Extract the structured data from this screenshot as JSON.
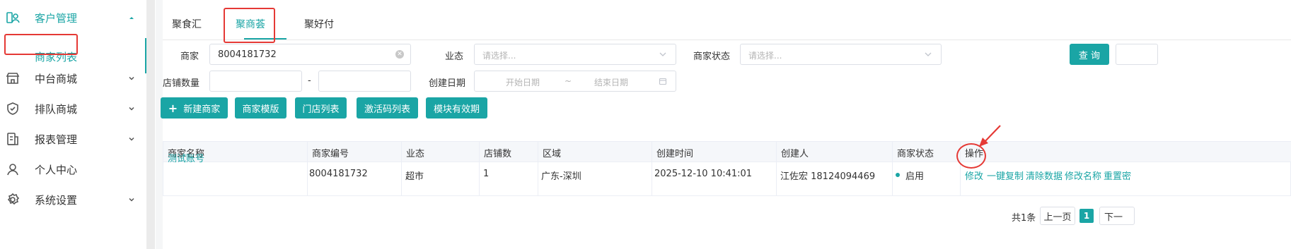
{
  "sidebar": {
    "items": [
      {
        "label": "客户管理",
        "icon": "customer-icon"
      },
      {
        "label": "中台商城",
        "icon": "store-icon"
      },
      {
        "label": "排队商城",
        "icon": "shield-icon"
      },
      {
        "label": "报表管理",
        "icon": "report-icon"
      },
      {
        "label": "个人中心",
        "icon": "user-icon"
      },
      {
        "label": "系统设置",
        "icon": "gear-icon"
      }
    ],
    "sub_item": "商家列表"
  },
  "tabs": [
    "聚食汇",
    "聚商荟",
    "聚好付"
  ],
  "filters": {
    "merchant_label": "商家",
    "merchant_value": "8004181732",
    "format_label": "业态",
    "format_placeholder": "请选择...",
    "status_label": "商家状态",
    "status_placeholder": "请选择...",
    "store_count_label": "店铺数量",
    "range_sep": "-",
    "date_label": "创建日期",
    "date_start": "开始日期",
    "date_tilde": "~",
    "date_end": "结束日期",
    "query_button": "查 询"
  },
  "actions": {
    "new_merchant": "新建商家",
    "merchant_template": "商家模版",
    "store_list": "门店列表",
    "activation_codes": "激活码列表",
    "module_validity": "模块有效期"
  },
  "table": {
    "headers": [
      "商家名称",
      "商家编号",
      "业态",
      "店铺数",
      "区域",
      "创建时间",
      "创建人",
      "商家状态",
      "操作"
    ],
    "rows": [
      {
        "name": "测试账号",
        "code": "8004181732",
        "format": "超市",
        "stores": "1",
        "region": "广东-深圳",
        "created": "2025-12-10 10:41:01",
        "creator": "江佐宏 18124094469",
        "status": "启用",
        "ops": [
          "修改",
          "一键复制",
          "清除数据",
          "修改名称",
          "重置密"
        ]
      }
    ]
  },
  "pager": {
    "total": "共1条",
    "prev": "上一页",
    "current": "1",
    "next": "下一"
  },
  "colors": {
    "accent": "#1aa5a5",
    "annotation": "#e53935"
  }
}
